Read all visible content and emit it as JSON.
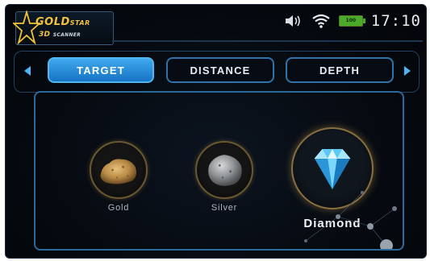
{
  "brand": {
    "line1": "GOLD",
    "line1_small": "STAR",
    "line2": "3D",
    "line2_small": "SCANNER"
  },
  "status": {
    "sound_icon": "speaker-icon",
    "wifi_icon": "wifi-icon",
    "battery_level": "100",
    "time": "17:10"
  },
  "nav": {
    "prev_icon": "triangle-left-icon",
    "next_icon": "triangle-right-icon"
  },
  "tabs": [
    {
      "label": "TARGET",
      "active": true
    },
    {
      "label": "DISTANCE",
      "active": false
    },
    {
      "label": "DEPTH",
      "active": false
    }
  ],
  "targets": [
    {
      "label": "Gold",
      "selected": false,
      "icon": "gold-nugget-icon"
    },
    {
      "label": "Silver",
      "selected": false,
      "icon": "silver-ore-icon"
    },
    {
      "label": "Diamond",
      "selected": true,
      "icon": "diamond-icon"
    }
  ],
  "colors": {
    "accent": "#3fa9ee",
    "brand_gold": "#f2c23a",
    "battery": "#4caa2a",
    "background": "#05080d"
  }
}
